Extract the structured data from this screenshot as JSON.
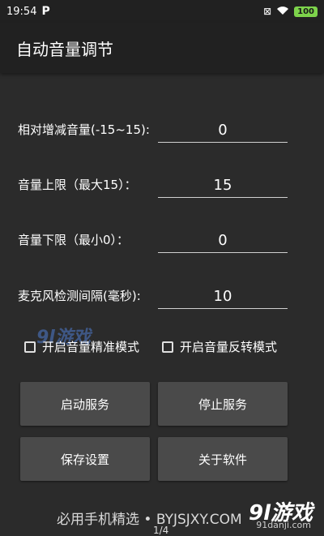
{
  "status_bar": {
    "time": "19:54",
    "app_icon": "P",
    "battery": "100"
  },
  "app_bar": {
    "title": "自动音量调节"
  },
  "fields": [
    {
      "label": "相对增减音量(-15~15):",
      "value": "0"
    },
    {
      "label": "音量上限（最大15）：",
      "value": "15"
    },
    {
      "label": "音量下限（最小0）：",
      "value": "0"
    },
    {
      "label": "麦克风检测间隔(毫秒):",
      "value": "10"
    }
  ],
  "checkboxes": [
    {
      "label": "开启音量精准模式",
      "checked": false
    },
    {
      "label": "开启音量反转模式",
      "checked": false
    }
  ],
  "buttons": {
    "start": "启动服务",
    "stop": "停止服务",
    "save": "保存设置",
    "about": "关于软件"
  },
  "watermark": {
    "text": "9l游戏"
  },
  "footer": {
    "text": "必用手机精选 • BYJSJXY.COM",
    "pager": "1/4",
    "logo": "9l游戏",
    "logo_sub": "91danji.com"
  }
}
